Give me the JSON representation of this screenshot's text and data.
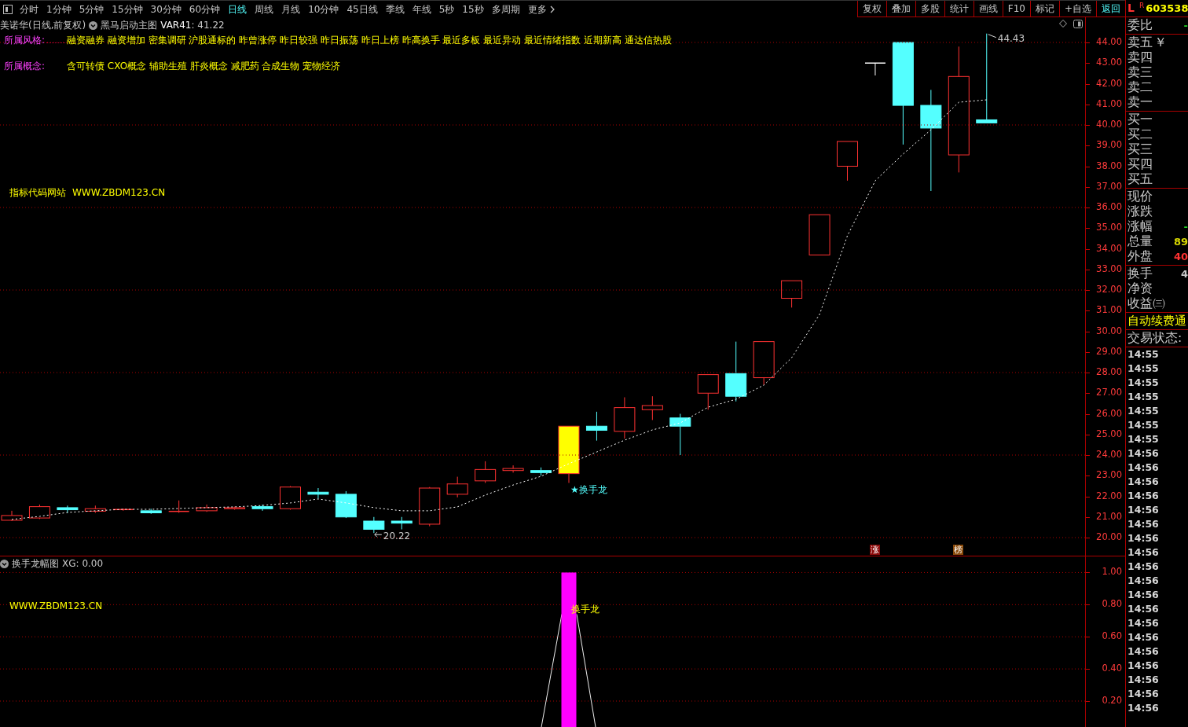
{
  "toolbar": {
    "periods": [
      {
        "label": "分时",
        "selected": false
      },
      {
        "label": "1分钟",
        "selected": false
      },
      {
        "label": "5分钟",
        "selected": false
      },
      {
        "label": "15分钟",
        "selected": false
      },
      {
        "label": "30分钟",
        "selected": false
      },
      {
        "label": "60分钟",
        "selected": false
      },
      {
        "label": "日线",
        "selected": true
      },
      {
        "label": "周线",
        "selected": false
      },
      {
        "label": "月线",
        "selected": false
      },
      {
        "label": "10分钟",
        "selected": false
      },
      {
        "label": "45日线",
        "selected": false
      },
      {
        "label": "季线",
        "selected": false
      },
      {
        "label": "年线",
        "selected": false
      },
      {
        "label": "5秒",
        "selected": false
      },
      {
        "label": "15秒",
        "selected": false
      },
      {
        "label": "多周期",
        "selected": false
      }
    ],
    "more": "更多",
    "buttons": [
      {
        "label": "复权",
        "selected": false
      },
      {
        "label": "叠加",
        "selected": false
      },
      {
        "label": "多股",
        "selected": false
      },
      {
        "label": "统计",
        "selected": false
      },
      {
        "label": "画线",
        "selected": false
      },
      {
        "label": "F10",
        "selected": false
      },
      {
        "label": "标记",
        "selected": false
      },
      {
        "label": "+自选",
        "selected": false
      },
      {
        "label": "返回",
        "selected": true
      }
    ]
  },
  "chart_header": {
    "title": "美诺华(日线,前复权)",
    "indicator": "黑马启动主图",
    "value": ": 41.22"
  },
  "tags": [
    {
      "label": "所属风格:",
      "items": "融资融券 融资增加 密集调研 沪股通标的 昨曾涨停 昨日较强 昨日振荡 昨日上榜 昨高换手 最近多板 最近异动 最近情绪指数 近期新高 通达信热股"
    },
    {
      "label": "所属概念:",
      "items": "含可转债 CXO概念 辅助生殖 肝炎概念 减肥药 合成生物 宠物经济"
    }
  ],
  "site_note": {
    "label": "指标代码网站",
    "url": "WWW.ZBDM123.CN"
  },
  "main_chart": {
    "chart_data": {
      "type": "line",
      "grid": true,
      "ylim": [
        20,
        44
      ],
      "yticks": [
        {
          "value": 20,
          "label": "20.00"
        },
        {
          "value": 21,
          "label": "21.00"
        },
        {
          "value": 22,
          "label": "22.00"
        },
        {
          "value": 23,
          "label": "23.00"
        },
        {
          "value": 24,
          "label": "24.00"
        },
        {
          "value": 25,
          "label": "25.00"
        },
        {
          "value": 26,
          "label": "26.00"
        },
        {
          "value": 27,
          "label": "27.00"
        },
        {
          "value": 28,
          "label": "28.00"
        },
        {
          "value": 29,
          "label": "29.00"
        },
        {
          "value": 30,
          "label": "30.00"
        },
        {
          "value": 31,
          "label": "31.00"
        },
        {
          "value": 32,
          "label": "32.00"
        },
        {
          "value": 33,
          "label": "33.00"
        },
        {
          "value": 34,
          "label": "34.00"
        },
        {
          "value": 35,
          "label": "35.00"
        },
        {
          "value": 36,
          "label": "36.00"
        },
        {
          "value": 37,
          "label": "37.00"
        },
        {
          "value": 38,
          "label": "38.00"
        },
        {
          "value": 39,
          "label": "39.00"
        },
        {
          "value": 40,
          "label": "40.00"
        },
        {
          "value": 41,
          "label": "41.00"
        },
        {
          "value": 42,
          "label": "42.00"
        },
        {
          "value": 43,
          "label": "43.00"
        },
        {
          "value": 44,
          "label": "44.00"
        }
      ],
      "series": [
        {
          "name": "VAR41",
          "color": "#ffffff",
          "line_style": "dashed",
          "values": [
            20.88,
            21.03,
            21.22,
            21.3,
            21.37,
            21.37,
            21.41,
            21.45,
            21.49,
            21.56,
            21.68,
            21.87,
            21.68,
            21.45,
            21.3,
            21.3,
            21.49,
            22.06,
            22.55,
            22.97,
            23.58,
            24.15,
            24.72,
            25.22,
            25.56,
            26.32,
            26.7,
            27.39,
            28.72,
            30.82,
            34.63,
            37.3,
            38.59,
            39.77,
            41.1,
            41.22,
            null,
            null,
            null
          ]
        }
      ],
      "annotations": [
        "44.43",
        "20.22",
        "★换手龙"
      ]
    },
    "markers": [
      {
        "text": "涨",
        "color": "#8b0a0a"
      },
      {
        "text": "榜",
        "color": "#8a4a0a"
      }
    ]
  },
  "sub_chart": {
    "title": "换手龙幅图",
    "value": "XG: 0.00",
    "site": "WWW.ZBDM123.CN",
    "chart_data": {
      "type": "bar",
      "grid": true,
      "ylim": [
        0.2,
        1.1
      ],
      "yticks": [
        {
          "value": 0.2,
          "label": "0.20"
        },
        {
          "value": 0.4,
          "label": "0.40"
        },
        {
          "value": 0.6,
          "label": "0.60"
        },
        {
          "value": 0.8,
          "label": "0.80"
        },
        {
          "value": 1.0,
          "label": "1.00"
        }
      ],
      "values": [
        null,
        null,
        null,
        null,
        null,
        null,
        null,
        null,
        null,
        null,
        null,
        null,
        null,
        null,
        null,
        null,
        null,
        null,
        null,
        null,
        1.0,
        null,
        null,
        null,
        null,
        null,
        null,
        null,
        null,
        null,
        null,
        null,
        null,
        null,
        null,
        null,
        null,
        null,
        null
      ],
      "annotations": [
        "换手龙"
      ]
    }
  },
  "quote_panel": {
    "market": "L",
    "flag": "R",
    "code": "603538",
    "sections": [
      [
        {
          "label": "委比",
          "value": "-",
          "color": "#22cc22"
        }
      ],
      [
        {
          "label": "卖五",
          "mark": "￥"
        },
        {
          "label": "卖四"
        },
        {
          "label": "卖三"
        },
        {
          "label": "卖二"
        },
        {
          "label": "卖一"
        }
      ],
      [
        {
          "label": "买一"
        },
        {
          "label": "买二"
        },
        {
          "label": "买三"
        },
        {
          "label": "买四"
        },
        {
          "label": "买五"
        }
      ],
      [
        {
          "label": "现价"
        },
        {
          "label": "涨跌"
        },
        {
          "label": "涨幅",
          "value": "-",
          "color": "#22cc22"
        },
        {
          "label": "总量",
          "value": "89",
          "color": "#d8d800"
        },
        {
          "label": "外盘",
          "value": "40",
          "color": "#ff3232"
        }
      ],
      [
        {
          "label": "换手",
          "value": "4",
          "color": "#c8c8c8"
        },
        {
          "label": "净资"
        },
        {
          "label": "收益㈢"
        }
      ]
    ],
    "notice": "自动续费通",
    "trade_status": "交易状态:",
    "times": [
      "14:55",
      "14:55",
      "14:55",
      "14:55",
      "14:55",
      "14:55",
      "14:55",
      "14:56",
      "14:56",
      "14:56",
      "14:56",
      "14:56",
      "14:56",
      "14:56",
      "14:56",
      "14:56",
      "14:56",
      "14:56",
      "14:56",
      "14:56",
      "14:56",
      "14:56",
      "14:56",
      "14:56",
      "14:56",
      "14:56"
    ]
  }
}
